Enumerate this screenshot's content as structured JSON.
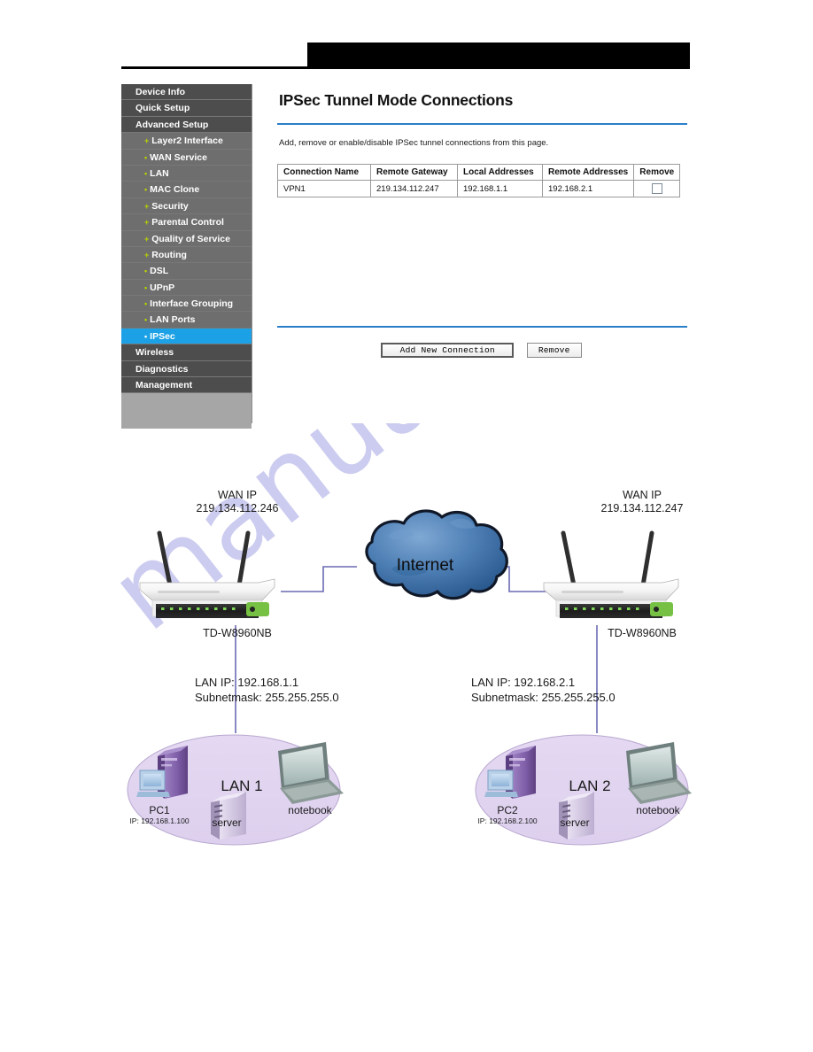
{
  "header": {
    "redaction": "",
    "rule": ""
  },
  "watermark": {
    "text": "manualsarchive.com"
  },
  "sidebar": {
    "items": [
      {
        "label": "Device Info",
        "level": "top",
        "bullet": "none",
        "selected": false
      },
      {
        "label": "Quick Setup",
        "level": "top",
        "bullet": "none",
        "selected": false
      },
      {
        "label": "Advanced Setup",
        "level": "top",
        "bullet": "none",
        "selected": false
      },
      {
        "label": "Layer2 Interface",
        "level": "sub",
        "bullet": "plus",
        "selected": false
      },
      {
        "label": "WAN Service",
        "level": "sub",
        "bullet": "dot",
        "selected": false
      },
      {
        "label": "LAN",
        "level": "sub",
        "bullet": "dot",
        "selected": false
      },
      {
        "label": "MAC Clone",
        "level": "sub",
        "bullet": "dot",
        "selected": false
      },
      {
        "label": "Security",
        "level": "sub",
        "bullet": "plus",
        "selected": false
      },
      {
        "label": "Parental Control",
        "level": "sub",
        "bullet": "plus",
        "selected": false
      },
      {
        "label": "Quality of Service",
        "level": "sub",
        "bullet": "plus",
        "selected": false
      },
      {
        "label": "Routing",
        "level": "sub",
        "bullet": "plus",
        "selected": false
      },
      {
        "label": "DSL",
        "level": "sub",
        "bullet": "dot",
        "selected": false
      },
      {
        "label": "UPnP",
        "level": "sub",
        "bullet": "dot",
        "selected": false
      },
      {
        "label": "Interface Grouping",
        "level": "sub",
        "bullet": "dot",
        "selected": false
      },
      {
        "label": "LAN Ports",
        "level": "sub",
        "bullet": "dot",
        "selected": false
      },
      {
        "label": "IPSec",
        "level": "sub",
        "bullet": "dot",
        "selected": true
      },
      {
        "label": "Wireless",
        "level": "top",
        "bullet": "none",
        "selected": false
      },
      {
        "label": "Diagnostics",
        "level": "top",
        "bullet": "none",
        "selected": false
      },
      {
        "label": "Management",
        "level": "top",
        "bullet": "none",
        "selected": false
      }
    ]
  },
  "content": {
    "title": "IPSec Tunnel Mode Connections",
    "intro": "Add, remove or enable/disable IPSec tunnel connections from this page.",
    "table": {
      "headers": [
        "Connection Name",
        "Remote Gateway",
        "Local Addresses",
        "Remote Addresses",
        "Remove"
      ],
      "rows": [
        {
          "connection_name": "VPN1",
          "remote_gateway": "219.134.112.247",
          "local_addresses": "192.168.1.1",
          "remote_addresses": "192.168.2.1",
          "remove_checked": false
        }
      ]
    },
    "buttons": {
      "add": "Add New Connection",
      "remove": "Remove"
    },
    "colors": {
      "accent_rule": "#2a7fc9",
      "selected_nav": "#1ca1e6",
      "nav_top_bg": "#4d4d4d",
      "nav_sub_bg": "#6e6e6e"
    }
  },
  "diagram": {
    "cloud_label": "Internet",
    "left": {
      "wan_caption": "WAN IP",
      "wan_ip": "219.134.112.246",
      "model": "TD-W8960NB",
      "lan_ip_line": "LAN IP: 192.168.1.1",
      "subnet_line": "Subnetmask: 255.255.255.0",
      "lan_title": "LAN 1",
      "pc_label": "PC1",
      "pc_ip": "IP: 192.168.1.100",
      "server_label": "server",
      "notebook_label": "notebook"
    },
    "right": {
      "wan_caption": "WAN IP",
      "wan_ip": "219.134.112.247",
      "model": "TD-W8960NB",
      "lan_ip_line": "LAN IP: 192.168.2.1",
      "subnet_line": "Subnetmask: 255.255.255.0",
      "lan_title": "LAN 2",
      "pc_label": "PC2",
      "pc_ip": "IP: 192.168.2.100",
      "server_label": "server",
      "notebook_label": "notebook"
    }
  }
}
